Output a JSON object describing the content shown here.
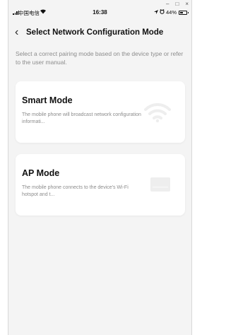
{
  "window_controls": {
    "minimize": "–",
    "maximize": "□",
    "close": "×"
  },
  "status_bar": {
    "carrier": "中国电信",
    "time": "16:38",
    "battery": "44%",
    "battery_level": 0.44
  },
  "nav": {
    "title": "Select Network Configuration Mode"
  },
  "hint": "Select a correct pairing mode based on the device type or refer to the user manual.",
  "modes": [
    {
      "title": "Smart Mode",
      "description": "The mobile phone will broadcast network configuration informati...",
      "icon": "wifi-icon"
    },
    {
      "title": "AP Mode",
      "description": "The mobile phone connects to the device's Wi-Fi hotspot and t...",
      "icon": "device-icon"
    }
  ]
}
